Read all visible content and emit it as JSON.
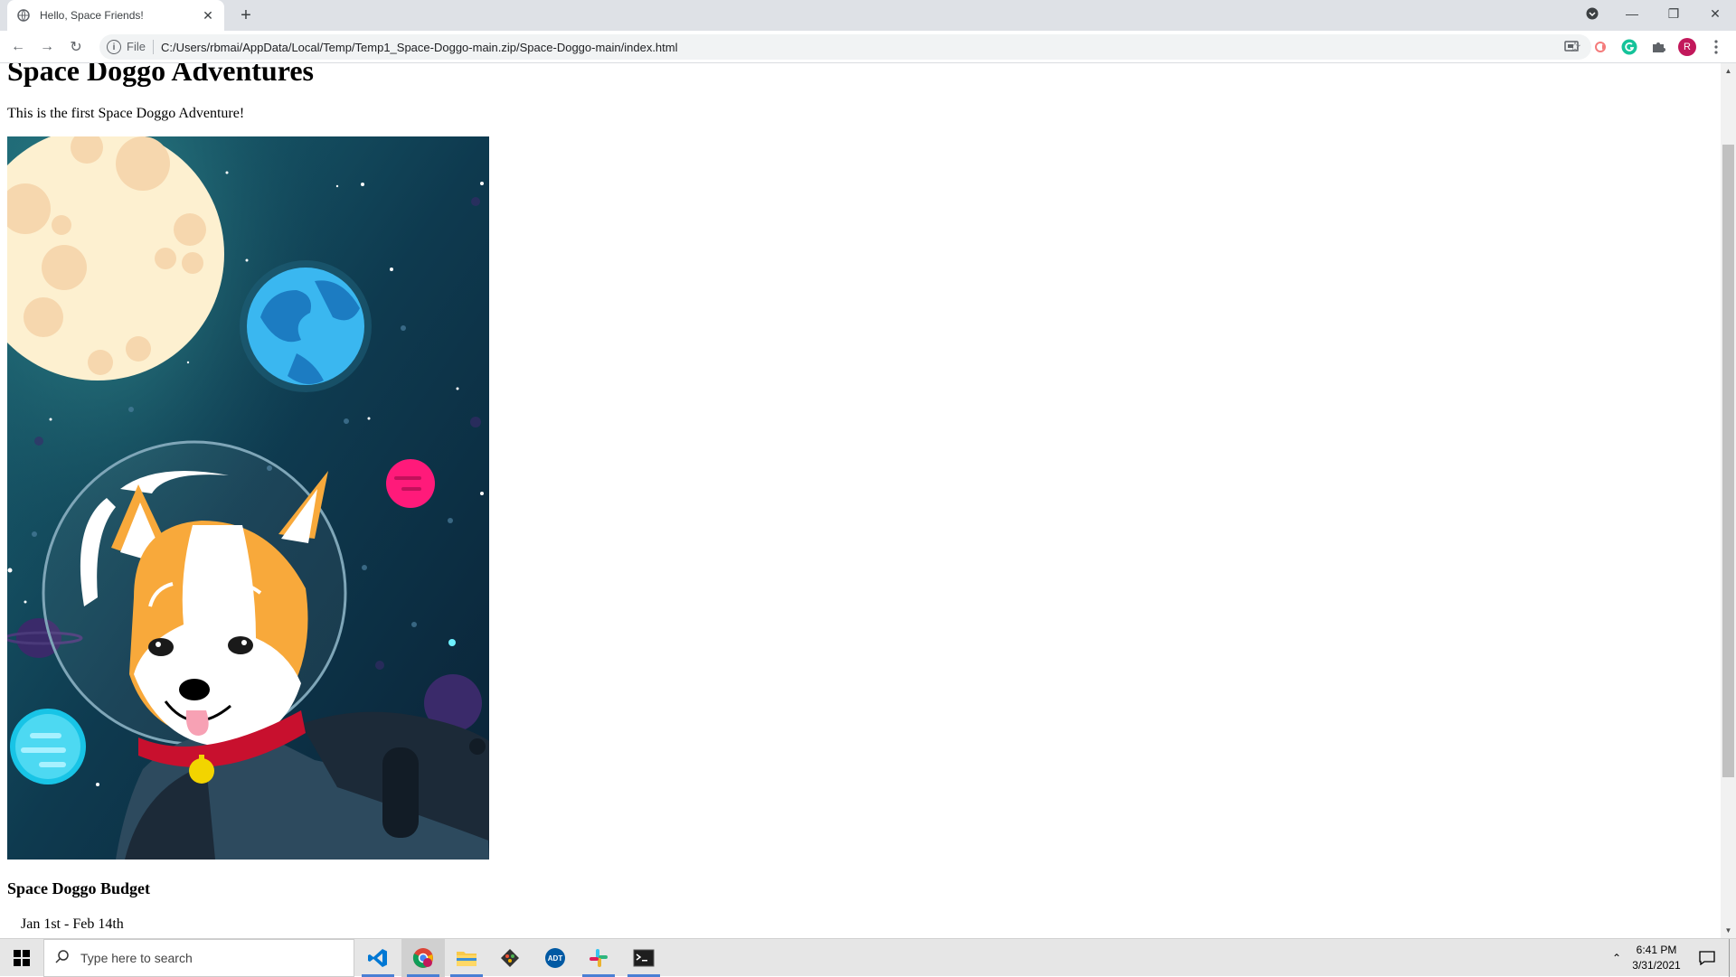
{
  "browser": {
    "tab_title": "Hello, Space Friends!",
    "new_tab_symbol": "+",
    "address_scheme": "File",
    "address_url": "C:/Users/rbmai/AppData/Local/Temp/Temp1_Space-Doggo-main.zip/Space-Doggo-main/index.html",
    "profile_initial": "R"
  },
  "page": {
    "heading": "Space Doggo Adventures",
    "intro": "This is the first Space Doggo Adventure!",
    "budget_heading": "Space Doggo Budget",
    "budget_line": "Jan 1st - Feb 14th"
  },
  "taskbar": {
    "search_placeholder": "Type here to search",
    "time": "6:41 PM",
    "date": "3/31/2021"
  },
  "colors": {
    "space_bg": "#0e3a4f",
    "moon": "#fdf0d0",
    "corgi_orange": "#f8a93b",
    "collar": "#c8102e",
    "pink_planet": "#ff1a7a"
  }
}
